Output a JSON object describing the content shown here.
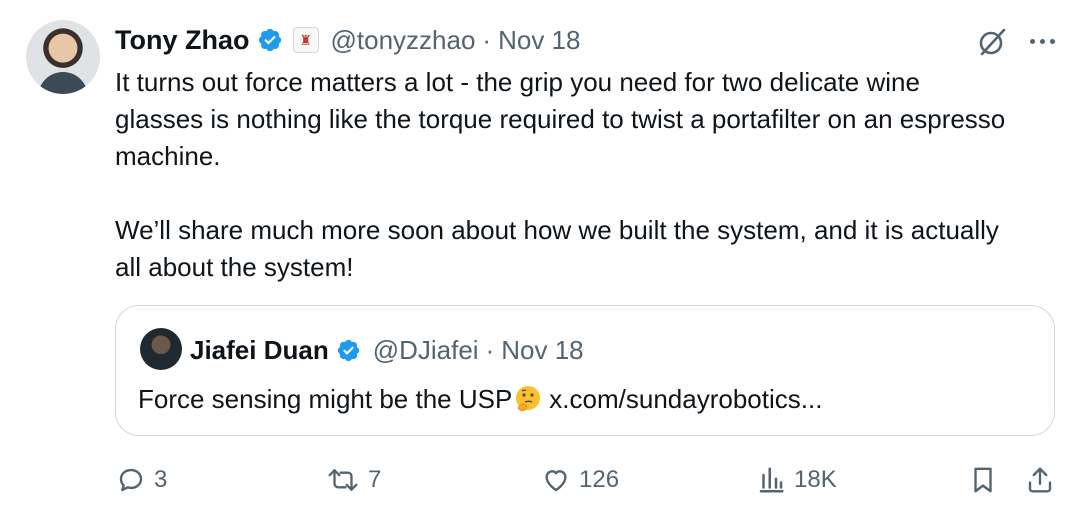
{
  "author": {
    "name": "Tony Zhao",
    "handle": "@tonyzzhao",
    "separator": "·",
    "date": "Nov 18"
  },
  "tweet": {
    "paragraphs": [
      "It turns out force matters a lot - the grip you need for two delicate wine glasses is nothing like the torque required to twist a portafilter on an espresso machine.",
      "We’ll share much more soon about how we built the system, and it is actually all about the system!"
    ]
  },
  "quote": {
    "name": "Jiafei Duan",
    "handle": "@DJiafei",
    "separator": "·",
    "date": "Nov 18",
    "text": "Force sensing might be the USP",
    "emoji": "thinking-face",
    "link": "x.com/sundayrobotics..."
  },
  "actions": {
    "replies": "3",
    "reposts": "7",
    "likes": "126",
    "views": "18K"
  },
  "colors": {
    "text": "#0f1419",
    "muted": "#536471",
    "verified": "#1d9bf0",
    "border": "#cfd9de"
  },
  "icons": [
    "verified-badge-icon",
    "affiliate-badge-icon",
    "grok-icon",
    "more-icon",
    "reply-icon",
    "repost-icon",
    "like-icon",
    "views-icon",
    "bookmark-icon",
    "share-icon"
  ]
}
